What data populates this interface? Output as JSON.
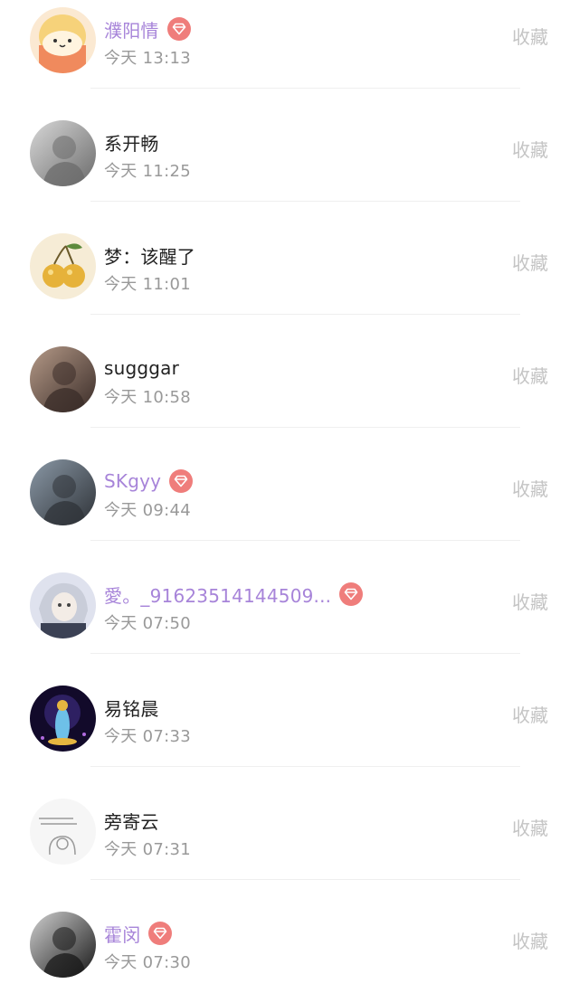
{
  "items": [
    {
      "name": "濮阳情",
      "vip": true,
      "time": "今天 13:13",
      "action": "收藏",
      "avatar_icon": "cartoon-avatar",
      "avatar_colors": [
        "#f6d27a",
        "#f08a5d"
      ]
    },
    {
      "name": "系开畅",
      "vip": false,
      "time": "今天 11:25",
      "action": "收藏",
      "avatar_icon": "photo-avatar",
      "avatar_colors": [
        "#d8d8d8",
        "#6b6b6b"
      ]
    },
    {
      "name": "梦：该醒了",
      "vip": false,
      "time": "今天 11:01",
      "action": "收藏",
      "avatar_icon": "cherry-avatar",
      "avatar_colors": [
        "#f6ecd6",
        "#e6b23a"
      ]
    },
    {
      "name": "sugggar",
      "vip": false,
      "time": "今天 10:58",
      "action": "收藏",
      "avatar_icon": "photo-avatar",
      "avatar_colors": [
        "#b59a88",
        "#3a2c28"
      ]
    },
    {
      "name": "SKgyy",
      "vip": true,
      "time": "今天 09:44",
      "action": "收藏",
      "avatar_icon": "photo-avatar",
      "avatar_colors": [
        "#8a98a6",
        "#2f3338"
      ]
    },
    {
      "name": "愛。_91623514144509...",
      "vip": true,
      "time": "今天 07:50",
      "action": "收藏",
      "avatar_icon": "anime-avatar",
      "avatar_colors": [
        "#dfe2ee",
        "#3b4154"
      ]
    },
    {
      "name": "易铭晨",
      "vip": false,
      "time": "今天 07:33",
      "action": "收藏",
      "avatar_icon": "glow-avatar",
      "avatar_colors": [
        "#120a2a",
        "#e6b640"
      ]
    },
    {
      "name": "旁寄云",
      "vip": false,
      "time": "今天 07:31",
      "action": "收藏",
      "avatar_icon": "sketch-avatar",
      "avatar_colors": [
        "#f6f6f6",
        "#9a9a9a"
      ]
    },
    {
      "name": "霍闵",
      "vip": true,
      "time": "今天 07:30",
      "action": "收藏",
      "avatar_icon": "photo-avatar",
      "avatar_colors": [
        "#d0d0d0",
        "#181818"
      ]
    }
  ],
  "vip_badge_icon": "diamond-icon",
  "colors": {
    "vip_name": "#a784d9",
    "name": "#222222",
    "time": "#999999",
    "action": "#c4c4c4",
    "badge": "#ef7d7b"
  }
}
